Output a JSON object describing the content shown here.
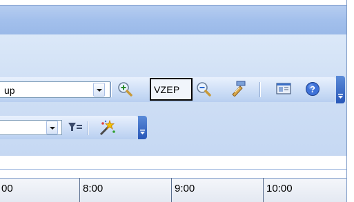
{
  "toolbar": {
    "group_combo_value": "up",
    "vzep_label": "VZEP"
  },
  "timeline": {
    "hours": [
      "00",
      "8:00",
      "9:00",
      "10:00"
    ]
  },
  "icons": {
    "zoom_in": "zoom-in-icon",
    "zoom_out": "zoom-out-icon",
    "properties": "properties-icon",
    "print_preview": "print-preview-icon",
    "help": "help-icon",
    "filter": "filter-icon",
    "wizard": "magic-wand-icon"
  }
}
